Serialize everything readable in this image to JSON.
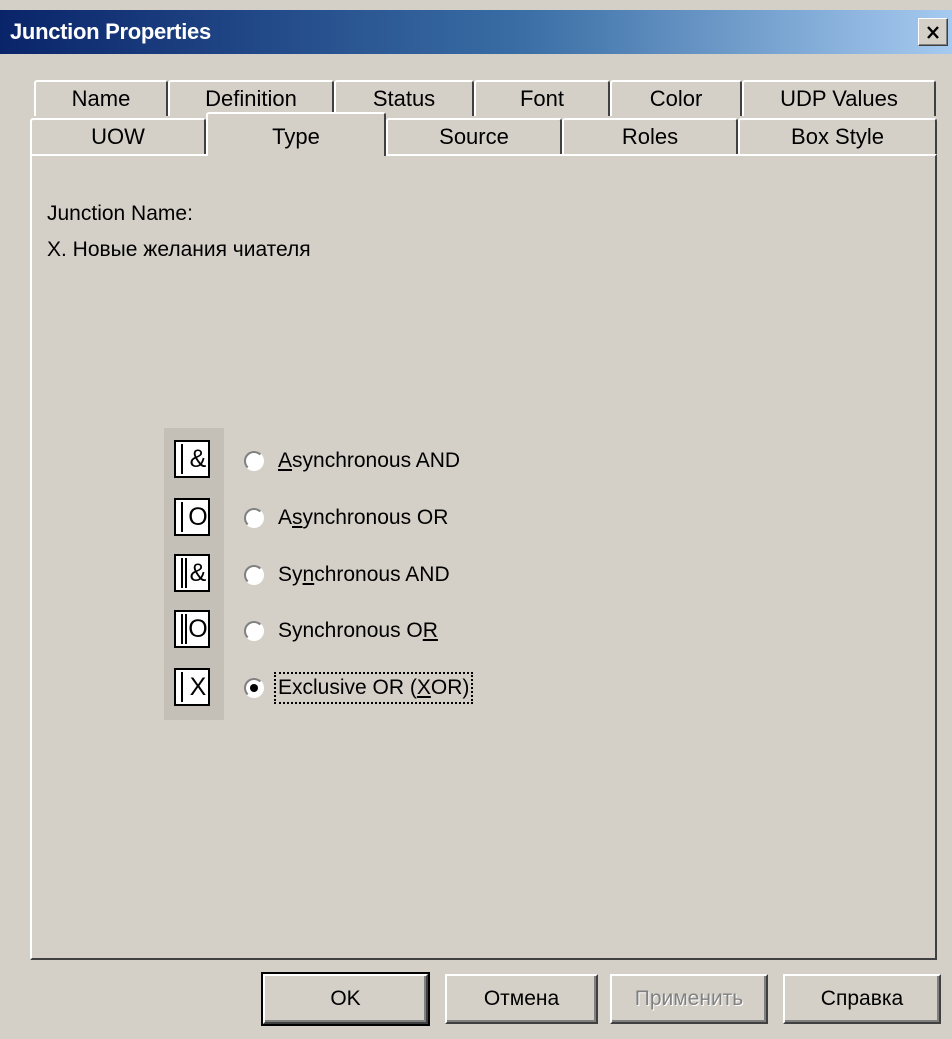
{
  "window": {
    "title": "Junction Properties",
    "close_icon": "close-icon"
  },
  "tabs": {
    "row1": [
      "Name",
      "Definition",
      "Status",
      "Font",
      "Color",
      "UDP Values"
    ],
    "row2": [
      "UOW",
      "Type",
      "Source",
      "Roles",
      "Box Style"
    ],
    "active": "Type"
  },
  "panel": {
    "name_label": "Junction Name:",
    "name_value": "X. Новые желания чиателя"
  },
  "junction_types": [
    {
      "label": "Asynchronous AND",
      "mnemonic": "A",
      "icon": "async-and-icon",
      "symbol": "&",
      "checked": false
    },
    {
      "label": "Asynchronous OR",
      "mnemonic": "s",
      "icon": "async-or-icon",
      "symbol": "O",
      "checked": false
    },
    {
      "label": "Synchronous AND",
      "mnemonic": "n",
      "icon": "sync-and-icon",
      "symbol": "&",
      "checked": false
    },
    {
      "label": "Synchronous OR",
      "mnemonic": "R",
      "icon": "sync-or-icon",
      "symbol": "O",
      "checked": false
    },
    {
      "label": "Exclusive OR (XOR)",
      "mnemonic": "X",
      "icon": "xor-icon",
      "symbol": "X",
      "checked": true
    }
  ],
  "buttons": {
    "ok": "OK",
    "cancel": "Отмена",
    "apply": "Применить",
    "help": "Справка"
  }
}
